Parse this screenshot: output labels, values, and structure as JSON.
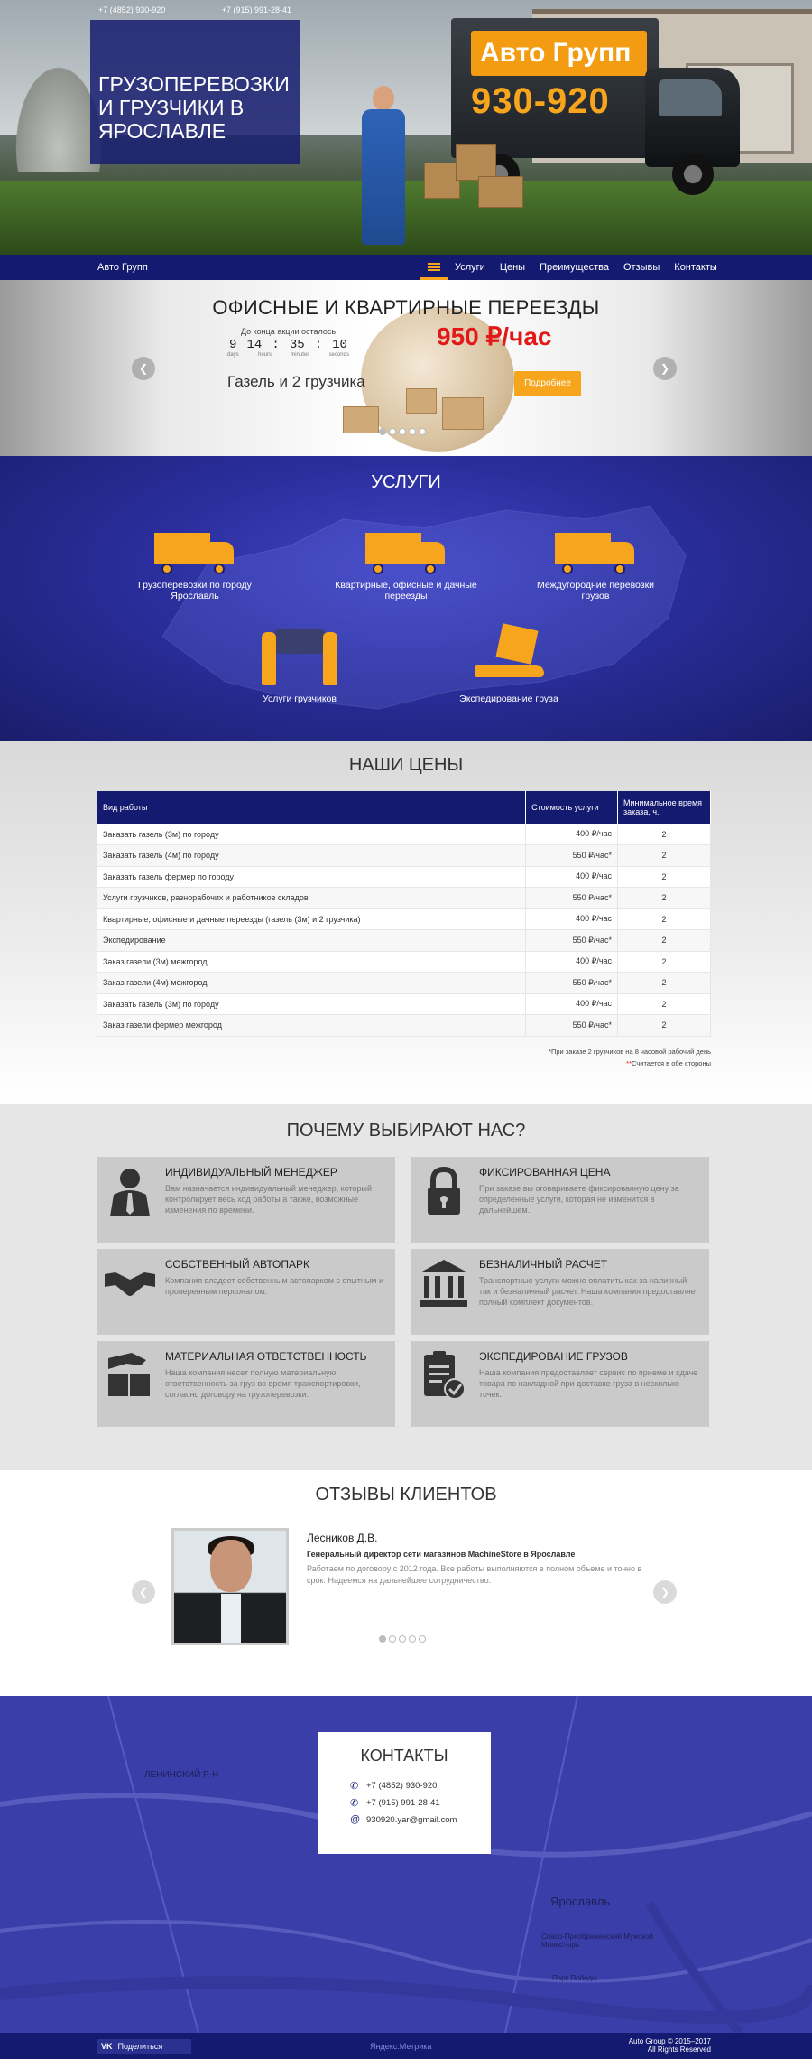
{
  "hero": {
    "phone1": "+7 (4852) 930-920",
    "phone2": "+7 (915) 991-28-41",
    "title": "Грузоперевозки и грузчики в Ярославле",
    "truck_brand": "Авто Групп",
    "truck_number": "930-920"
  },
  "nav": {
    "logo": "Авто Групп",
    "items": [
      {
        "label": "Услуги"
      },
      {
        "label": "Цены"
      },
      {
        "label": "Преимущества"
      },
      {
        "label": "Отзывы"
      },
      {
        "label": "Контакты"
      }
    ]
  },
  "slider": {
    "title": "ОФИСНЫЕ И КВАРТИРНЫЕ ПЕРЕЕЗДЫ",
    "countdown_title": "До конца акции осталось",
    "countdown": {
      "days": "9",
      "hours": "14",
      "minutes": "35",
      "seconds": "10"
    },
    "countdown_labels": {
      "days": "days",
      "hours": "hours",
      "minutes": "minutes",
      "seconds": "seconds"
    },
    "price": "950 ₽/час",
    "subline": "Газель и 2 грузчика",
    "button": "Подробнее",
    "prev": "❮",
    "next": "❯"
  },
  "services": {
    "title": "УСЛУГИ",
    "items": [
      {
        "label": "Грузоперевозки по городу Ярославль",
        "icon": "truck-city-icon"
      },
      {
        "label": "Квартирные, офисные и дачные переезды",
        "icon": "truck-move-icon"
      },
      {
        "label": "Междугородние перевозки грузов",
        "icon": "truck-intercity-icon"
      },
      {
        "label": "Услуги грузчиков",
        "icon": "movers-icon"
      },
      {
        "label": "Экспедирование груза",
        "icon": "cargo-hand-icon"
      }
    ]
  },
  "prices": {
    "title": "НАШИ ЦЕНЫ",
    "headers": [
      "Вид работы",
      "Стоимость услуги",
      "Минимальное время заказа, ч."
    ],
    "rows": [
      [
        "Заказать газель (3м) по городу",
        "400 ₽/час",
        "2"
      ],
      [
        "Заказать газель (4м) по городу",
        "550 ₽/час*",
        "2"
      ],
      [
        "Заказать газель фермер по городу",
        "400 ₽/час",
        "2"
      ],
      [
        "Услуги грузчиков, разнорабочих и работников складов",
        "550 ₽/час*",
        "2"
      ],
      [
        "Квартирные, офисные и дачные переезды (газель (3м) и 2 грузчика)",
        "400 ₽/час",
        "2"
      ],
      [
        "Экспедирование",
        "550 ₽/час*",
        "2"
      ],
      [
        "Заказ газели (3м) межгород",
        "400 ₽/час",
        "2"
      ],
      [
        "Заказ газели (4м) межгород",
        "550 ₽/час*",
        "2"
      ],
      [
        "Заказать газель (3м) по городу",
        "400 ₽/час",
        "2"
      ],
      [
        "Заказ газели фермер межгород",
        "550 ₽/час*",
        "2"
      ]
    ],
    "note1": "*При заказе 2 грузчиков на 8 часовой рабочий день",
    "note2_mark": "**",
    "note2": "Считается в обе стороны"
  },
  "why": {
    "title": "ПОЧЕМУ ВЫБИРАЮТ НАС?",
    "cards": [
      {
        "title": "Индивидуальный менеджер",
        "text": "Вам назначается индивидуальный менеджер, который контролирует весь ход работы а также, возможные изменения по времени.",
        "icon": "manager-icon"
      },
      {
        "title": "Фиксированная цена",
        "text": "При заказе вы оговариваете фиксированную цену за определенные услуги, которая не изменится в дальнейшем.",
        "icon": "lock-icon"
      },
      {
        "title": "Собственный автопарк",
        "text": "Компания владеет собственным автопарком с опытным и проверенным персоналом.",
        "icon": "handshake-icon"
      },
      {
        "title": "Безналичный расчет",
        "text": "Транспортные услуги можно оплатить как за наличный так и безналичный расчет. Наша компания предоставляет полный комплект документов.",
        "icon": "bank-icon"
      },
      {
        "title": "Материальная ответственность",
        "text": "Наша компания несет полную материальную ответственность за груз во время транспортировки, согласно договору на грузоперевозки.",
        "icon": "cargo-insurance-icon"
      },
      {
        "title": "Экспедирование грузов",
        "text": "Наша компания предоставляет сервис по приеме и сдаче товара по накладной при доставке груза в несколько точек.",
        "icon": "clipboard-check-icon"
      }
    ]
  },
  "reviews": {
    "title": "ОТЗЫВЫ КЛИЕНТОВ",
    "name": "Лесников Д.В.",
    "role": "Генеральный директор сети магазинов MachineStore в Ярославле",
    "text": "Работаем по договору с 2012 года. Все работы выполняются в полном объеме и точно в срок. Надеемся на дальнейшее сотрудничество.",
    "prev": "❮",
    "next": "❯"
  },
  "contacts": {
    "title": "КОНТАКТЫ",
    "phone1": "+7 (4852) 930-920",
    "phone2": "+7 (915) 991-28-41",
    "email": "930920.yar@gmail.com",
    "map_labels": {
      "district": "ЛЕНИНСКИЙ Р-Н",
      "city": "Ярославль",
      "monastery": "Спасо-Преображенский Мужской Монастырь",
      "park": "Парк Победы"
    }
  },
  "footer": {
    "share": "Поделиться",
    "vk": "VK",
    "metrika": "Яндекс.Метрика",
    "copyright": "Auto Group © 2015–2017",
    "rights": "All Rights Reserved"
  },
  "colors": {
    "navy": "#141a70",
    "accent": "#f7a51c",
    "price_red": "#e21919",
    "services_bg": "#2a2e9c",
    "contacts_bg": "#3a3ea8"
  }
}
